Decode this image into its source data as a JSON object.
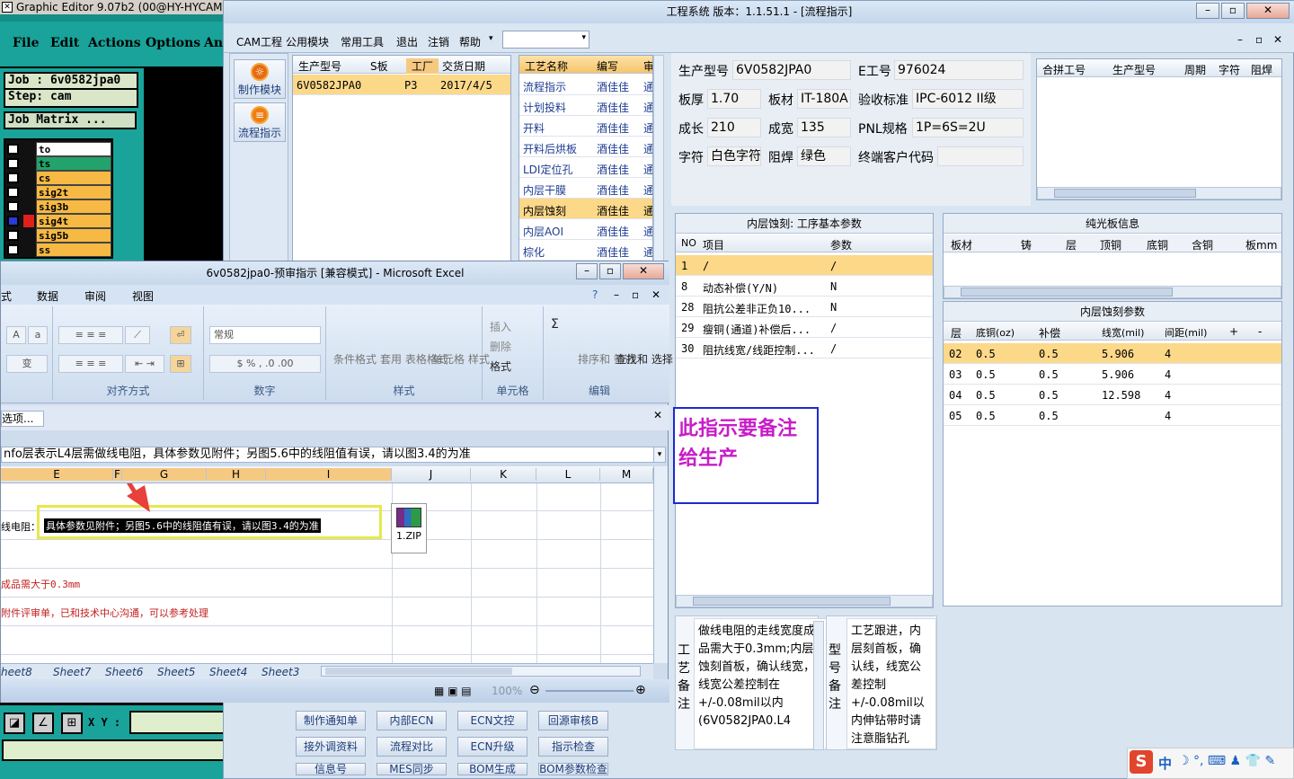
{
  "graphic_editor": {
    "title": "Graphic Editor 9.07b2 (00@HY-HYCAM",
    "menu": [
      "File",
      "Edit",
      "Actions",
      "Options",
      "Ana"
    ],
    "job": "Job : 6v0582jpa0",
    "step": "Step: cam",
    "job_matrix": "Job Matrix ...",
    "layers": [
      "to",
      "ts",
      "cs",
      "sig2t",
      "sig3b",
      "sig4t",
      "sig5b",
      "ss"
    ],
    "xy_label": "X Y :",
    "colors": {
      "teal": "#19a39a",
      "layer_yellow": "#f5b944",
      "layer_green": "#22a36c"
    }
  },
  "main": {
    "title": "工程系统  版本：1.1.51.1 - [流程指示]",
    "menu": [
      "CAM工程",
      "公用模块",
      "常用工具",
      "退出",
      "注销",
      "帮助"
    ],
    "sidebar": [
      {
        "label": "制作模块",
        "icon": "gear-icon"
      },
      {
        "label": "流程指示",
        "icon": "flow-icon"
      }
    ],
    "job_grid": {
      "headers": [
        "生产型号",
        "S板",
        "工厂",
        "交货日期"
      ],
      "rows": [
        [
          "6V0582JPA0",
          "",
          "P3",
          "2017/4/5"
        ]
      ]
    },
    "process_grid": {
      "headers": [
        "工艺名称",
        "编写",
        "审"
      ],
      "rows": [
        [
          "流程指示",
          "酒佳佳",
          "通"
        ],
        [
          "计划投料",
          "酒佳佳",
          "通"
        ],
        [
          "开料",
          "酒佳佳",
          "通"
        ],
        [
          "开料后烘板",
          "酒佳佳",
          "通"
        ],
        [
          "LDI定位孔",
          "酒佳佳",
          "通"
        ],
        [
          "内层干膜",
          "酒佳佳",
          "通"
        ],
        [
          "内层蚀刻",
          "酒佳佳",
          "通"
        ],
        [
          "内层AOI",
          "酒佳佳",
          "通"
        ],
        [
          "棕化",
          "酒佳佳",
          "通"
        ]
      ],
      "selected": 6
    },
    "info": {
      "model_label": "生产型号",
      "model": "6V0582JPA0",
      "e_label": "E工号",
      "e_no": "976024",
      "thick_label": "板厚",
      "thick": "1.70",
      "mat_label": "板材",
      "mat": "IT-180A",
      "std_label": "验收标准",
      "std": "IPC-6012 II级",
      "len_label": "成长",
      "len": "210",
      "wid_label": "成宽",
      "wid": "135",
      "pnl_label": "PNL规格",
      "pnl": "1P=6S=2U",
      "char_label": "字符",
      "char": "白色字符",
      "mask_label": "阻焊",
      "mask": "绿色",
      "cust_label": "终端客户代码",
      "cust": ""
    },
    "merge_grid": {
      "headers": [
        "合拼工号",
        "生产型号",
        "周期",
        "字符",
        "阻焊"
      ]
    },
    "param_panel": {
      "title": "内层蚀刻: 工序基本参数",
      "headers": [
        "NO",
        "项目",
        "参数"
      ],
      "rows": [
        [
          "1",
          "/",
          "/"
        ],
        [
          "8",
          "动态补偿(Y/N)",
          "N"
        ],
        [
          "28",
          "阻抗公差非正负10...",
          "N"
        ],
        [
          "29",
          "瘦铜(通道)补偿后...",
          "/"
        ],
        [
          "30",
          "阻抗线宽/线距控制...",
          "/"
        ]
      ]
    },
    "bare_board": {
      "title": "纯光板信息",
      "headers": [
        "板材",
        "铸",
        "层",
        "顶铜",
        "底铜",
        "含铜",
        "板mm"
      ]
    },
    "etch_params": {
      "title": "内层蚀刻参数",
      "headers": [
        "层",
        "底铜(oz)",
        "补偿",
        "线宽(mil)",
        "间距(mil)",
        "+",
        "-"
      ],
      "rows": [
        [
          "02",
          "0.5",
          "0.5",
          "5.906",
          "4"
        ],
        [
          "03",
          "0.5",
          "0.5",
          "5.906",
          "4"
        ],
        [
          "04",
          "0.5",
          "0.5",
          "12.598",
          "4"
        ],
        [
          "05",
          "0.5",
          "0.5",
          "",
          "4"
        ]
      ]
    },
    "annotation": "此指示要备注给生产",
    "process_note_label": [
      "工",
      "艺",
      "备",
      "注"
    ],
    "process_note": "做线电阻的走线宽度成品需大于0.3mm;内层蚀刻首板，确认线宽，线宽公差控制在+/-0.08mil以内(6V0582JPA0.L4",
    "model_note_label": [
      "型",
      "号",
      "备",
      "注"
    ],
    "model_note": "工艺跟进，内层刻首板，确认线，线宽公差控制+/-0.08mil以内伸钻带时请注意脂钻孔szdrl层也一并拉伸",
    "bottom_buttons": [
      [
        "制作通知单",
        "内部ECN",
        "ECN文控",
        "回源审核B"
      ],
      [
        "接外调资料",
        "流程对比",
        "ECN升级",
        "指示检查"
      ],
      [
        "信息号",
        "MES同步",
        "BOM生成",
        "BOM参数检查"
      ]
    ]
  },
  "excel": {
    "title": "6v0582jpa0-预审指示 [兼容模式] - Microsoft Excel",
    "tabs": [
      "式",
      "数据",
      "审阅",
      "视图"
    ],
    "ribbon": {
      "align_group": "对齐方式",
      "number_group": "数字",
      "number_format": "常规",
      "style_group": "样式",
      "cond_format": "条件格式",
      "table_format": "套用\n表格格式",
      "cell_style": "单元格\n样式",
      "cells_group": "单元格",
      "insert": "插入",
      "delete": "删除",
      "format": "格式",
      "edit_group": "编辑",
      "sort_filter": "排序和\n筛选",
      "find_select": "查找和\n选择"
    },
    "name_box": "选项...",
    "formula": "nfo层表示L4层需做线电阻，具体参数见附件；另图5.6中的线阻值有误，请以图3.4的为准",
    "columns": [
      "E",
      "F",
      "G",
      "H",
      "I",
      "J",
      "K",
      "L",
      "M"
    ],
    "cells": {
      "row1_prefix": "线电阻：",
      "highlight": "具体参数见附件；另图5.6中的线阻值有误，请以图3.4的为准",
      "row3": "成品需大于0.3mm",
      "row4": "附件评审单，已和技术中心沟通，可以参考处理"
    },
    "attachment": "1.ZIP",
    "sheets": [
      "heet8",
      "Sheet7",
      "Sheet6",
      "Sheet5",
      "Sheet4",
      "Sheet3"
    ],
    "zoom": "100%"
  },
  "taskbar": {
    "ime": "中"
  }
}
